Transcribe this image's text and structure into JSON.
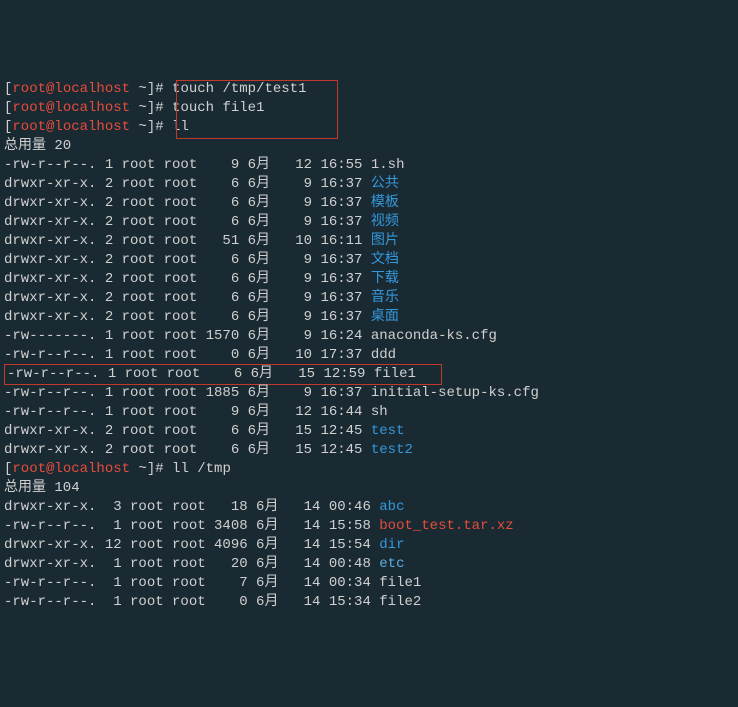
{
  "prompts": [
    {
      "prefix": "[root@localhost ~]# ",
      "cmd": "touch /tmp/test1"
    },
    {
      "prefix": "[root@localhost ~]# ",
      "cmd": "touch file1"
    },
    {
      "prefix": "[root@localhost ~]# ",
      "cmd": "ll"
    }
  ],
  "total1": "总用量 20",
  "listing1": [
    {
      "perm": "-rw-r--r--.",
      "ln": "1",
      "usr": "root",
      "grp": "root",
      "sz": "   9",
      "mo": "6月",
      "dy": " 12",
      "tm": "16:55",
      "nm": "1.sh",
      "cls": "white"
    },
    {
      "perm": "drwxr-xr-x.",
      "ln": "2",
      "usr": "root",
      "grp": "root",
      "sz": "   6",
      "mo": "6月",
      "dy": "  9",
      "tm": "16:37",
      "nm": "公共",
      "cls": "blue"
    },
    {
      "perm": "drwxr-xr-x.",
      "ln": "2",
      "usr": "root",
      "grp": "root",
      "sz": "   6",
      "mo": "6月",
      "dy": "  9",
      "tm": "16:37",
      "nm": "模板",
      "cls": "blue"
    },
    {
      "perm": "drwxr-xr-x.",
      "ln": "2",
      "usr": "root",
      "grp": "root",
      "sz": "   6",
      "mo": "6月",
      "dy": "  9",
      "tm": "16:37",
      "nm": "视频",
      "cls": "blue"
    },
    {
      "perm": "drwxr-xr-x.",
      "ln": "2",
      "usr": "root",
      "grp": "root",
      "sz": "  51",
      "mo": "6月",
      "dy": " 10",
      "tm": "16:11",
      "nm": "图片",
      "cls": "blue"
    },
    {
      "perm": "drwxr-xr-x.",
      "ln": "2",
      "usr": "root",
      "grp": "root",
      "sz": "   6",
      "mo": "6月",
      "dy": "  9",
      "tm": "16:37",
      "nm": "文档",
      "cls": "blue"
    },
    {
      "perm": "drwxr-xr-x.",
      "ln": "2",
      "usr": "root",
      "grp": "root",
      "sz": "   6",
      "mo": "6月",
      "dy": "  9",
      "tm": "16:37",
      "nm": "下载",
      "cls": "blue"
    },
    {
      "perm": "drwxr-xr-x.",
      "ln": "2",
      "usr": "root",
      "grp": "root",
      "sz": "   6",
      "mo": "6月",
      "dy": "  9",
      "tm": "16:37",
      "nm": "音乐",
      "cls": "blue"
    },
    {
      "perm": "drwxr-xr-x.",
      "ln": "2",
      "usr": "root",
      "grp": "root",
      "sz": "   6",
      "mo": "6月",
      "dy": "  9",
      "tm": "16:37",
      "nm": "桌面",
      "cls": "blue"
    },
    {
      "perm": "-rw-------.",
      "ln": "1",
      "usr": "root",
      "grp": "root",
      "sz": "1570",
      "mo": "6月",
      "dy": "  9",
      "tm": "16:24",
      "nm": "anaconda-ks.cfg",
      "cls": "white"
    },
    {
      "perm": "-rw-r--r--.",
      "ln": "1",
      "usr": "root",
      "grp": "root",
      "sz": "   0",
      "mo": "6月",
      "dy": " 10",
      "tm": "17:37",
      "nm": "ddd",
      "cls": "white"
    }
  ],
  "highlight": {
    "perm": "-rw-r--r--.",
    "ln": "1",
    "usr": "root",
    "grp": "root",
    "sz": "   6",
    "mo": "6月",
    "dy": " 15",
    "tm": "12:59",
    "nm": "file1",
    "cls": "white"
  },
  "listing1b": [
    {
      "perm": "-rw-r--r--.",
      "ln": "1",
      "usr": "root",
      "grp": "root",
      "sz": "1885",
      "mo": "6月",
      "dy": "  9",
      "tm": "16:37",
      "nm": "initial-setup-ks.cfg",
      "cls": "white"
    },
    {
      "perm": "-rw-r--r--.",
      "ln": "1",
      "usr": "root",
      "grp": "root",
      "sz": "   9",
      "mo": "6月",
      "dy": " 12",
      "tm": "16:44",
      "nm": "sh",
      "cls": "white"
    },
    {
      "perm": "drwxr-xr-x.",
      "ln": "2",
      "usr": "root",
      "grp": "root",
      "sz": "   6",
      "mo": "6月",
      "dy": " 15",
      "tm": "12:45",
      "nm": "test",
      "cls": "blue"
    },
    {
      "perm": "drwxr-xr-x.",
      "ln": "2",
      "usr": "root",
      "grp": "root",
      "sz": "   6",
      "mo": "6月",
      "dy": " 15",
      "tm": "12:45",
      "nm": "test2",
      "cls": "blue"
    }
  ],
  "prompt2": {
    "prefix": "[root@localhost ~]# ",
    "cmd": "ll /tmp"
  },
  "total2": "总用量 104",
  "listing2": [
    {
      "perm": "drwxr-xr-x.",
      "ln": " 3",
      "usr": "root",
      "grp": "root",
      "sz": "  18",
      "mo": "6月",
      "dy": " 14",
      "tm": "00:46",
      "nm": "abc",
      "cls": "blue"
    },
    {
      "perm": "-rw-r--r--.",
      "ln": " 1",
      "usr": "root",
      "grp": "root",
      "sz": "3408",
      "mo": "6月",
      "dy": " 14",
      "tm": "15:58",
      "nm": "boot_test.tar.xz",
      "cls": "red"
    },
    {
      "perm": "drwxr-xr-x.",
      "ln": "12",
      "usr": "root",
      "grp": "root",
      "sz": "4096",
      "mo": "6月",
      "dy": " 14",
      "tm": "15:54",
      "nm": "dir",
      "cls": "blue"
    },
    {
      "perm": "drwxr-xr-x.",
      "ln": " 1",
      "usr": "root",
      "grp": "root",
      "sz": "  20",
      "mo": "6月",
      "dy": " 14",
      "tm": "00:48",
      "nm": "etc",
      "cls": "cyan"
    },
    {
      "perm": "-rw-r--r--.",
      "ln": " 1",
      "usr": "root",
      "grp": "root",
      "sz": "   7",
      "mo": "6月",
      "dy": " 14",
      "tm": "00:34",
      "nm": "file1",
      "cls": "white"
    },
    {
      "perm": "-rw-r--r--.",
      "ln": " 1",
      "usr": "root",
      "grp": "root",
      "sz": "   0",
      "mo": "6月",
      "dy": " 14",
      "tm": "15:34",
      "nm": "file2",
      "cls": "white"
    }
  ]
}
